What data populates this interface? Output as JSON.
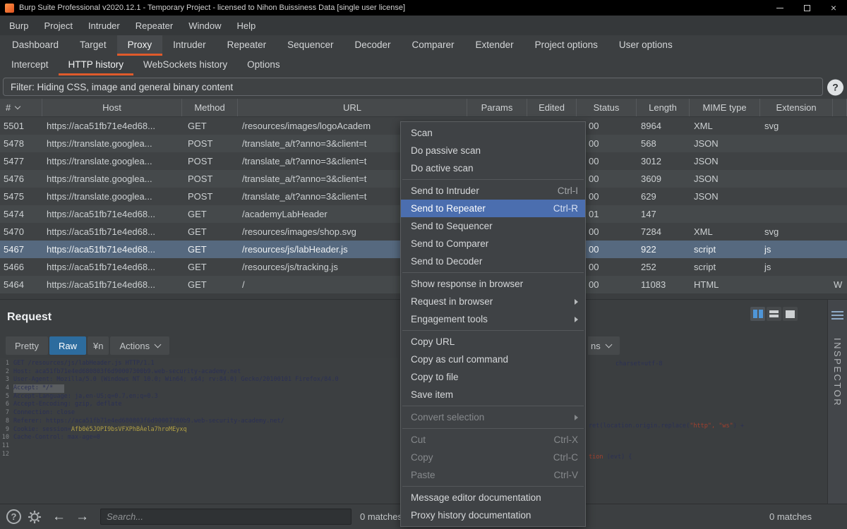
{
  "titlebar": {
    "title": "Burp Suite Professional v2020.12.1 - Temporary Project - licensed to Nihon Buissiness Data [single user license]"
  },
  "icons": {
    "help": "?",
    "close": "×",
    "back": "←",
    "forward": "→"
  },
  "menubar": {
    "items": [
      "Burp",
      "Project",
      "Intruder",
      "Repeater",
      "Window",
      "Help"
    ]
  },
  "main_tabs": {
    "items": [
      {
        "label": "Dashboard",
        "name": "dashboard"
      },
      {
        "label": "Target",
        "name": "target"
      },
      {
        "label": "Proxy",
        "name": "proxy",
        "selected": true
      },
      {
        "label": "Intruder",
        "name": "intruder"
      },
      {
        "label": "Repeater",
        "name": "repeater"
      },
      {
        "label": "Sequencer",
        "name": "sequencer"
      },
      {
        "label": "Decoder",
        "name": "decoder"
      },
      {
        "label": "Comparer",
        "name": "comparer"
      },
      {
        "label": "Extender",
        "name": "extender"
      },
      {
        "label": "Project options",
        "name": "project-options"
      },
      {
        "label": "User options",
        "name": "user-options"
      }
    ]
  },
  "sub_tabs": {
    "items": [
      {
        "label": "Intercept",
        "name": "intercept"
      },
      {
        "label": "HTTP history",
        "name": "http-history",
        "selected": true
      },
      {
        "label": "WebSockets history",
        "name": "websockets-history"
      },
      {
        "label": "Options",
        "name": "options"
      }
    ]
  },
  "filter_bar": {
    "text": "Filter: Hiding CSS, image and general binary content"
  },
  "history_table": {
    "columns": [
      {
        "label": "#",
        "name": "number",
        "sort": true
      },
      {
        "label": "Host",
        "name": "host"
      },
      {
        "label": "Method",
        "name": "method"
      },
      {
        "label": "URL",
        "name": "url"
      },
      {
        "label": "Params",
        "name": "params"
      },
      {
        "label": "Edited",
        "name": "edited"
      },
      {
        "label": "Status",
        "name": "status"
      },
      {
        "label": "Length",
        "name": "length"
      },
      {
        "label": "MIME type",
        "name": "mime-type"
      },
      {
        "label": "Extension",
        "name": "extension"
      },
      {
        "label": "",
        "name": "title"
      }
    ],
    "rows": [
      {
        "num": "5501",
        "host": "https://aca51fb71e4ed68...",
        "method": "GET",
        "url": "/resources/images/logoAcadem",
        "params": "",
        "edited": "",
        "status": "00",
        "length": "8964",
        "mime": "XML",
        "extension": "svg",
        "title": ""
      },
      {
        "num": "5478",
        "host": "https://translate.googlea...",
        "method": "POST",
        "url": "/translate_a/t?anno=3&client=t",
        "params": "",
        "edited": "",
        "status": "00",
        "length": "568",
        "mime": "JSON",
        "extension": "",
        "title": ""
      },
      {
        "num": "5477",
        "host": "https://translate.googlea...",
        "method": "POST",
        "url": "/translate_a/t?anno=3&client=t",
        "params": "",
        "edited": "",
        "status": "00",
        "length": "3012",
        "mime": "JSON",
        "extension": "",
        "title": ""
      },
      {
        "num": "5476",
        "host": "https://translate.googlea...",
        "method": "POST",
        "url": "/translate_a/t?anno=3&client=t",
        "params": "",
        "edited": "",
        "status": "00",
        "length": "3609",
        "mime": "JSON",
        "extension": "",
        "title": ""
      },
      {
        "num": "5475",
        "host": "https://translate.googlea...",
        "method": "POST",
        "url": "/translate_a/t?anno=3&client=t",
        "params": "",
        "edited": "",
        "status": "00",
        "length": "629",
        "mime": "JSON",
        "extension": "",
        "title": ""
      },
      {
        "num": "5474",
        "host": "https://aca51fb71e4ed68...",
        "method": "GET",
        "url": "/academyLabHeader",
        "params": "",
        "edited": "",
        "status": "01",
        "length": "147",
        "mime": "",
        "extension": "",
        "title": ""
      },
      {
        "num": "5470",
        "host": "https://aca51fb71e4ed68...",
        "method": "GET",
        "url": "/resources/images/shop.svg",
        "params": "",
        "edited": "",
        "status": "00",
        "length": "7284",
        "mime": "XML",
        "extension": "svg",
        "title": ""
      },
      {
        "num": "5467",
        "host": "https://aca51fb71e4ed68...",
        "method": "GET",
        "url": "/resources/js/labHeader.js",
        "params": "",
        "edited": "",
        "status": "00",
        "length": "922",
        "mime": "script",
        "extension": "js",
        "title": "",
        "selected": true
      },
      {
        "num": "5466",
        "host": "https://aca51fb71e4ed68...",
        "method": "GET",
        "url": "/resources/js/tracking.js",
        "params": "",
        "edited": "",
        "status": "00",
        "length": "252",
        "mime": "script",
        "extension": "js",
        "title": ""
      },
      {
        "num": "5464",
        "host": "https://aca51fb71e4ed68...",
        "method": "GET",
        "url": "/",
        "params": "",
        "edited": "",
        "status": "00",
        "length": "11083",
        "mime": "HTML",
        "extension": "",
        "title": "W"
      }
    ]
  },
  "context_menu": {
    "items": [
      {
        "label": "Scan",
        "name": "scan"
      },
      {
        "label": "Do passive scan",
        "name": "do-passive-scan"
      },
      {
        "label": "Do active scan",
        "name": "do-active-scan"
      },
      {
        "sep": true
      },
      {
        "label": "Send to Intruder",
        "name": "send-to-intruder",
        "shortcut": "Ctrl-I"
      },
      {
        "label": "Send to Repeater",
        "name": "send-to-repeater",
        "shortcut": "Ctrl-R",
        "highlighted": true
      },
      {
        "label": "Send to Sequencer",
        "name": "send-to-sequencer"
      },
      {
        "label": "Send to Comparer",
        "name": "send-to-comparer"
      },
      {
        "label": "Send to Decoder",
        "name": "send-to-decoder"
      },
      {
        "sep": true
      },
      {
        "label": "Show response in browser",
        "name": "show-response-in-browser"
      },
      {
        "label": "Request in browser",
        "name": "request-in-browser",
        "submenu": true
      },
      {
        "label": "Engagement tools",
        "name": "engagement-tools",
        "submenu": true
      },
      {
        "sep": true
      },
      {
        "label": "Copy URL",
        "name": "copy-url"
      },
      {
        "label": "Copy as curl command",
        "name": "copy-as-curl-command"
      },
      {
        "label": "Copy to file",
        "name": "copy-to-file"
      },
      {
        "label": "Save item",
        "name": "save-item"
      },
      {
        "sep": true
      },
      {
        "label": "Convert selection",
        "name": "convert-selection",
        "disabled": true,
        "submenu": true
      },
      {
        "sep": true
      },
      {
        "label": "Cut",
        "name": "cut",
        "shortcut": "Ctrl-X",
        "disabled": true
      },
      {
        "label": "Copy",
        "name": "copy",
        "shortcut": "Ctrl-C",
        "disabled": true
      },
      {
        "label": "Paste",
        "name": "paste",
        "shortcut": "Ctrl-V",
        "disabled": true
      },
      {
        "sep": true
      },
      {
        "label": "Message editor documentation",
        "name": "message-editor-documentation"
      },
      {
        "label": "Proxy history documentation",
        "name": "proxy-history-documentation"
      }
    ]
  },
  "request_panel": {
    "title": "Request",
    "tabs": [
      {
        "label": "Pretty",
        "name": "pretty"
      },
      {
        "label": "Raw",
        "name": "raw",
        "selected": true
      },
      {
        "label": "¥n",
        "name": "newline",
        "small": true
      },
      {
        "label": "Actions",
        "name": "actions",
        "dropdown": true
      }
    ],
    "lines": [
      {
        "n": "1",
        "text": "GET /resources/js/labHeader.js HTTP/1.1"
      },
      {
        "n": "2",
        "text": "Host: aca51fb71e4ed680803f6d90007300b9.web-security-academy.net"
      },
      {
        "n": "3",
        "text": "User-Agent: Mozilla/5.0 (Windows NT 10.0; Win64; x64; rv:84.0) Gecko/20100101 Firefox/84.0"
      },
      {
        "n": "4",
        "text": "Accept: */*",
        "selected": true
      },
      {
        "n": "5",
        "text": "Accept-Language: ja,en-US;q=0.7,en;q=0.3"
      },
      {
        "n": "6",
        "text": "Accept-Encoding: gzip, deflate"
      },
      {
        "n": "7",
        "text": "Connection: close"
      },
      {
        "n": "8",
        "text": "Referer: https://aca51fb71e4ed680803f6d90007300b9.web-security-academy.net/"
      },
      {
        "n": "9",
        "text": "Cookie: session=",
        "highlight": "Afb0é5JOPI9bsVFXPhBÀela7hroMEyxq"
      },
      {
        "n": "10",
        "text": "Cache-Control: max-age=0"
      },
      {
        "n": "11",
        "text": ""
      },
      {
        "n": "12",
        "text": ""
      }
    ]
  },
  "response_panel": {
    "actions_fragment": "ns",
    "fragments": {
      "charset": "charset=utf-8",
      "js_a": "ret(location.origin.replace(",
      "js_b": "\"http\", \"ws\"",
      "js_c": ") +",
      "fn_a": "tion",
      "fn_b": " (evt) {"
    }
  },
  "inspector": {
    "label": "INSPECTOR"
  },
  "bottom_bar": {
    "search_placeholder": "Search...",
    "left_matches": "0 matches",
    "right_matches": "0 matches"
  }
}
